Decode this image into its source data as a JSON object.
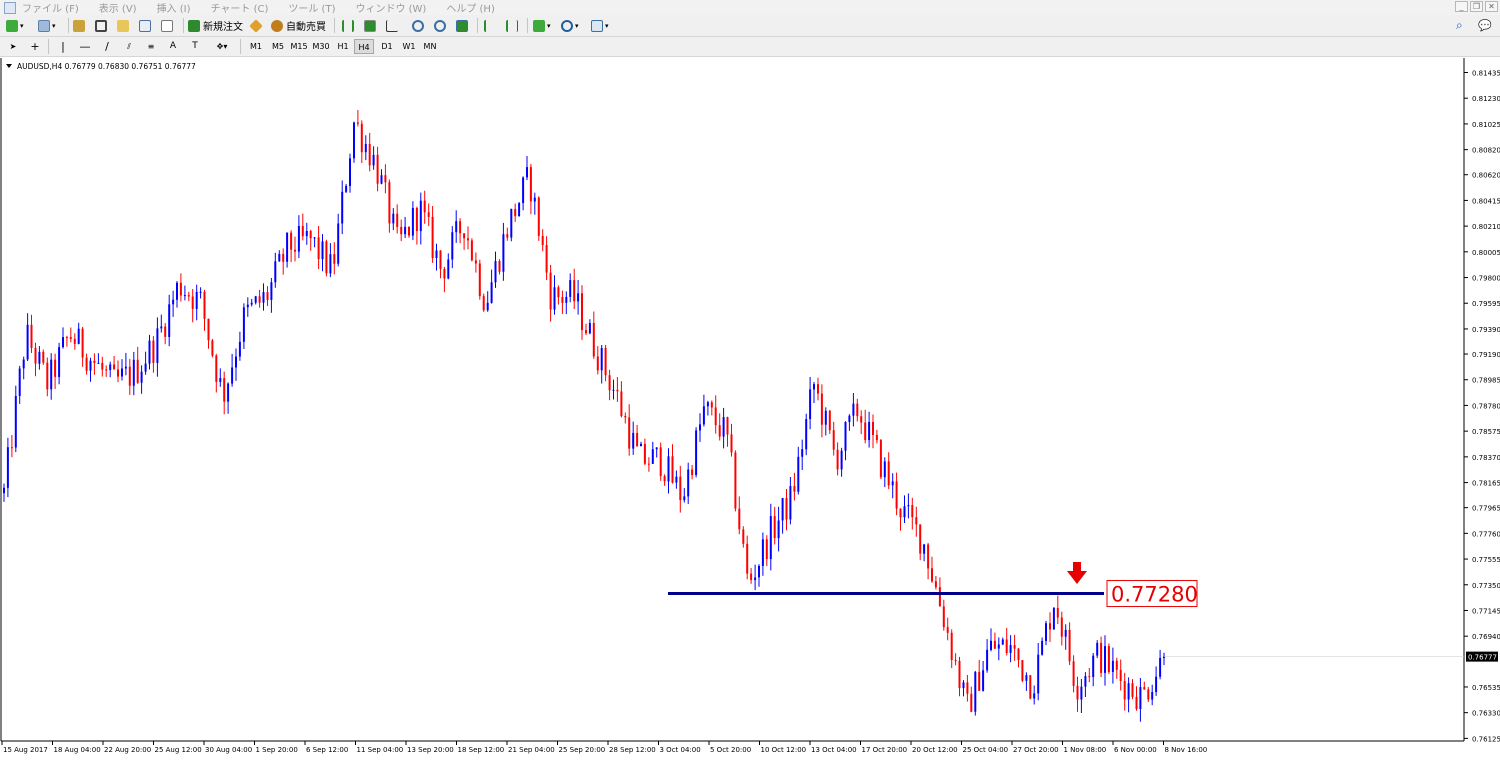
{
  "menu": [
    "ファイル (F)",
    "表示 (V)",
    "挿入 (I)",
    "チャート (C)",
    "ツール (T)",
    "ウィンドウ (W)",
    "ヘルプ (H)"
  ],
  "toolbar": {
    "new_order_label": "新規注文",
    "auto_trade_label": "自動売買"
  },
  "timeframes": [
    "M1",
    "M5",
    "M15",
    "M30",
    "H1",
    "H4",
    "D1",
    "W1",
    "MN"
  ],
  "active_timeframe": "H4",
  "chart_header": "AUDUSD,H4  0.76779 0.76830 0.76751 0.76777",
  "current_price_label": "0.76777",
  "annotation_label": "0.77280",
  "colors": {
    "bull": "#0000ff",
    "bear": "#ff0000",
    "hline": "#00008b",
    "annotation": "#e60000"
  },
  "chart_data": {
    "type": "candlestick",
    "symbol": "AUDUSD",
    "timeframe": "H4",
    "ohlc": {
      "open": 0.76779,
      "high": 0.7683,
      "low": 0.76751,
      "close": 0.76777
    },
    "ylim": [
      0.7612,
      0.81455
    ],
    "y_ticks": [
      "0.81435",
      "0.81230",
      "0.81025",
      "0.80820",
      "0.80620",
      "0.80415",
      "0.80210",
      "0.80005",
      "0.79800",
      "0.79595",
      "0.79390",
      "0.79190",
      "0.78985",
      "0.78780",
      "0.78575",
      "0.78370",
      "0.78165",
      "0.77965",
      "0.77760",
      "0.77555",
      "0.77350",
      "0.77145",
      "0.76940",
      "0.76777",
      "0.76535",
      "0.76330",
      "0.76125"
    ],
    "x_ticks": [
      "15 Aug 2017",
      "18 Aug 04:00",
      "22 Aug 20:00",
      "25 Aug 12:00",
      "30 Aug 04:00",
      "1 Sep 20:00",
      "6 Sep 12:00",
      "11 Sep 04:00",
      "13 Sep 20:00",
      "18 Sep 12:00",
      "21 Sep 04:00",
      "25 Sep 20:00",
      "28 Sep 12:00",
      "3 Oct 04:00",
      "5 Oct 20:00",
      "10 Oct 12:00",
      "13 Oct 04:00",
      "17 Oct 20:00",
      "20 Oct 12:00",
      "25 Oct 04:00",
      "27 Oct 20:00",
      "1 Nov 08:00",
      "6 Nov 00:00",
      "8 Nov 16:00"
    ],
    "horizontal_line": 0.7728,
    "current_price": 0.76777,
    "close_path": [
      0.7808,
      0.7935,
      0.7895,
      0.7935,
      0.7915,
      0.7895,
      0.7905,
      0.793,
      0.7975,
      0.796,
      0.7885,
      0.795,
      0.7965,
      0.8005,
      0.801,
      0.7985,
      0.8105,
      0.807,
      0.8005,
      0.8035,
      0.7985,
      0.8025,
      0.796,
      0.802,
      0.806,
      0.7965,
      0.7965,
      0.7925,
      0.7885,
      0.7835,
      0.7835,
      0.7805,
      0.7875,
      0.7855,
      0.7735,
      0.7775,
      0.7805,
      0.7895,
      0.7835,
      0.7875,
      0.7835,
      0.7795,
      0.777,
      0.7705,
      0.7635,
      0.7685,
      0.7685,
      0.7655,
      0.7725,
      0.7655,
      0.768,
      0.766,
      0.7645,
      0.7678
    ]
  }
}
